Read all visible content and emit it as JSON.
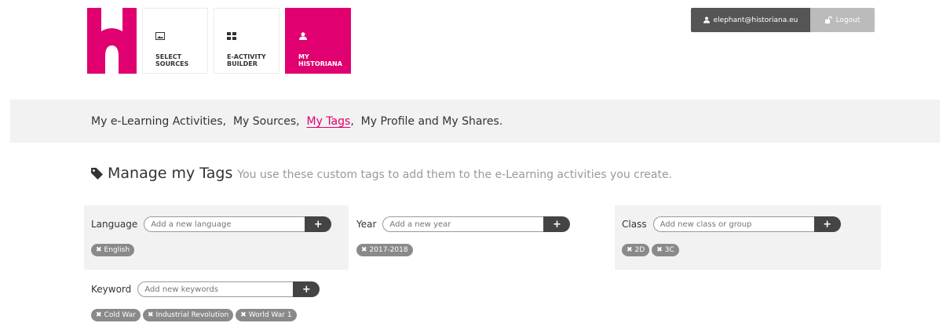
{
  "header": {
    "nav": [
      {
        "label": "SELECT\nSOURCES",
        "icon": "image-icon"
      },
      {
        "label": "E-ACTIVITY\nBUILDER",
        "icon": "grid-icon"
      },
      {
        "label": "MY\nHISTORIANA",
        "icon": "user-icon"
      }
    ],
    "user_email": "elephant@historiana.eu",
    "logout_label": "Logout",
    "brand_color": "#e0006f"
  },
  "subnav": {
    "activities": "My e-Learning Activities",
    "sources": "My Sources",
    "tags": "My Tags",
    "profile": "My Profile",
    "and": "and",
    "shares": "My Shares."
  },
  "page": {
    "title": "Manage my Tags",
    "description": "You use these custom tags to add them to the e-Learning activities you create."
  },
  "panels": {
    "language": {
      "label": "Language",
      "placeholder": "Add a new language",
      "add": "+",
      "tags": [
        "English"
      ]
    },
    "year": {
      "label": "Year",
      "placeholder": "Add a new year",
      "add": "+",
      "tags": [
        "2017-2018"
      ]
    },
    "class": {
      "label": "Class",
      "placeholder": "Add new class or group",
      "add": "+",
      "tags": [
        "2D",
        "3C"
      ]
    },
    "keyword": {
      "label": "Keyword",
      "placeholder": "Add new keywords",
      "add": "+",
      "tags": [
        "Cold War",
        "Industrial Revolution",
        "World War 1"
      ]
    }
  }
}
